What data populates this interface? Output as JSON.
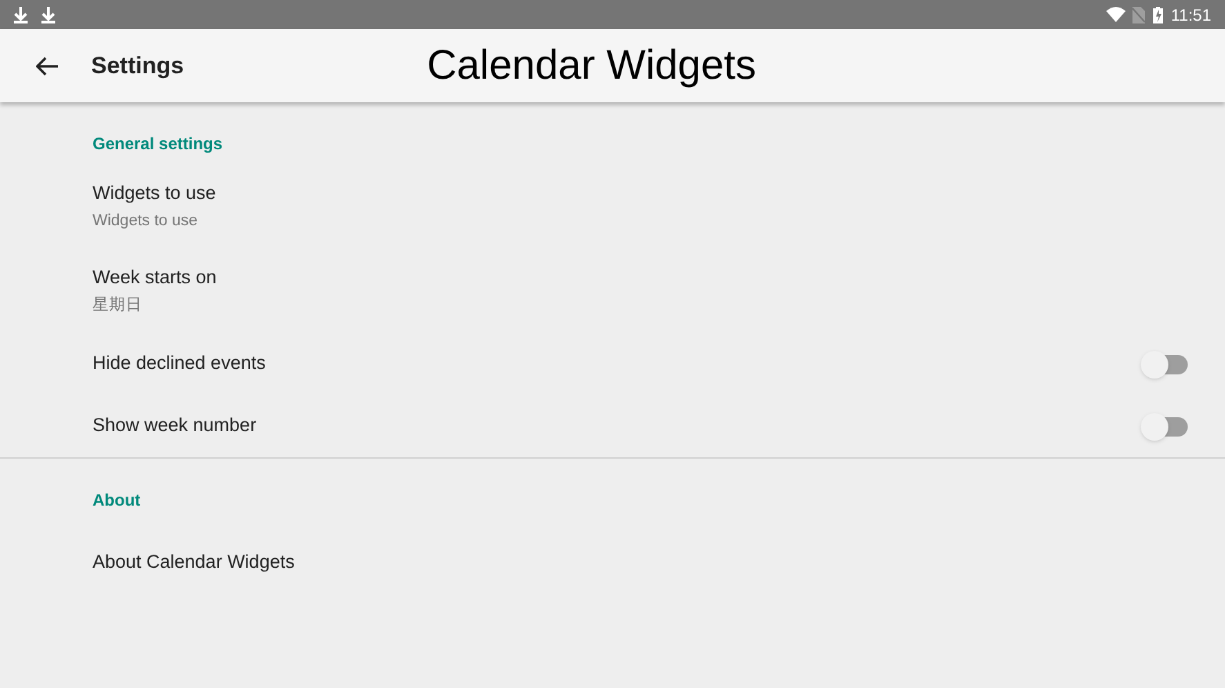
{
  "status_bar": {
    "time": "11:51"
  },
  "app_bar": {
    "title": "Settings",
    "overlay_title": "Calendar Widgets"
  },
  "sections": [
    {
      "title": "General settings",
      "items": [
        {
          "kind": "text",
          "title": "Widgets to use",
          "summary": "Widgets to use"
        },
        {
          "kind": "text",
          "title": "Week starts on",
          "summary": "星期日"
        },
        {
          "kind": "switch",
          "title": "Hide declined events",
          "on": false
        },
        {
          "kind": "switch",
          "title": "Show week number",
          "on": false
        }
      ]
    },
    {
      "title": "About",
      "items": [
        {
          "kind": "text",
          "title": "About Calendar Widgets"
        }
      ]
    }
  ]
}
